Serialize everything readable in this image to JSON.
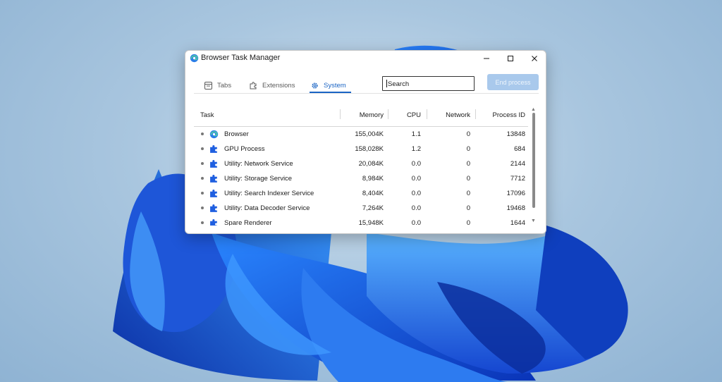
{
  "window": {
    "title": "Browser Task Manager",
    "controls": {
      "minimize": "minimize-icon",
      "maximize": "maximize-icon",
      "close": "close-icon"
    }
  },
  "tabs": [
    {
      "label": "Tabs",
      "icon": "tab-icon",
      "selected": false
    },
    {
      "label": "Extensions",
      "icon": "puzzle-icon",
      "selected": false
    },
    {
      "label": "System",
      "icon": "gear-icon",
      "selected": true
    }
  ],
  "search": {
    "value": "Search"
  },
  "end_process": {
    "label": "End process",
    "enabled": false
  },
  "table": {
    "headers": {
      "task": "Task",
      "memory": "Memory",
      "cpu": "CPU",
      "network": "Network",
      "pid": "Process ID"
    },
    "rows": [
      {
        "icon": "browser-icon",
        "task": "Browser",
        "memory": "155,004K",
        "cpu": "1.1",
        "network": "0",
        "pid": "13848"
      },
      {
        "icon": "puzzle-icon",
        "task": "GPU Process",
        "memory": "158,028K",
        "cpu": "1.2",
        "network": "0",
        "pid": "684"
      },
      {
        "icon": "puzzle-icon",
        "task": "Utility: Network Service",
        "memory": "20,084K",
        "cpu": "0.0",
        "network": "0",
        "pid": "2144"
      },
      {
        "icon": "puzzle-icon",
        "task": "Utility: Storage Service",
        "memory": "8,984K",
        "cpu": "0.0",
        "network": "0",
        "pid": "7712"
      },
      {
        "icon": "puzzle-icon",
        "task": "Utility: Search Indexer Service",
        "memory": "8,404K",
        "cpu": "0.0",
        "network": "0",
        "pid": "17096"
      },
      {
        "icon": "puzzle-icon",
        "task": "Utility: Data Decoder Service",
        "memory": "7,264K",
        "cpu": "0.0",
        "network": "0",
        "pid": "19468"
      },
      {
        "icon": "puzzle-icon",
        "task": "Spare Renderer",
        "memory": "15,948K",
        "cpu": "0.0",
        "network": "0",
        "pid": "1644"
      }
    ]
  },
  "colors": {
    "accent": "#1a64c4",
    "end_process_disabled": "#a9c9ec",
    "wallpaper_blue": "#1f5fe0"
  }
}
